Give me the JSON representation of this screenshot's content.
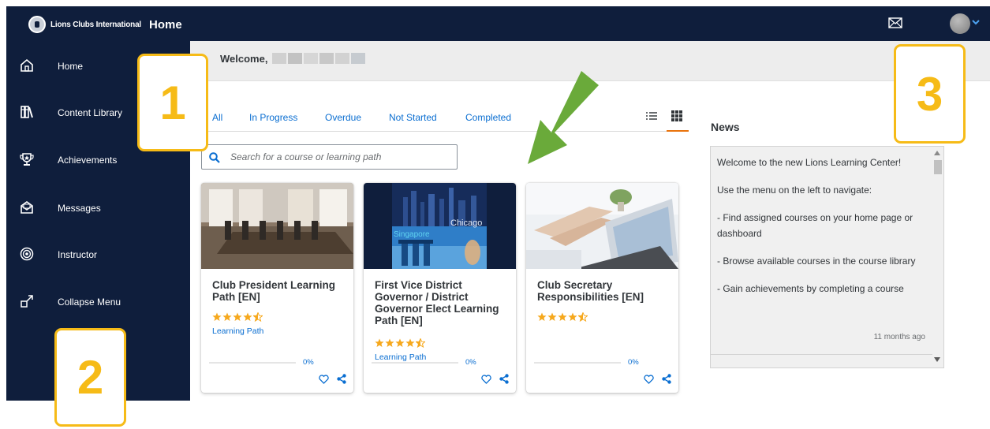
{
  "header": {
    "brand_name": "Lions Clubs International",
    "page_title": "Home",
    "mail_icon": "mail-icon",
    "avatar_icon": "avatar"
  },
  "sidebar": {
    "items": [
      {
        "label": "Home",
        "icon": "home-icon"
      },
      {
        "label": "Content Library",
        "icon": "library-icon"
      },
      {
        "label": "Achievements",
        "icon": "trophy-icon"
      },
      {
        "label": "Messages",
        "icon": "envelope-open-icon"
      },
      {
        "label": "Instructor",
        "icon": "instructor-icon"
      },
      {
        "label": "Collapse Menu",
        "icon": "collapse-icon"
      }
    ]
  },
  "welcome": {
    "text": "Welcome,"
  },
  "tabs": [
    {
      "label": "All"
    },
    {
      "label": "In Progress"
    },
    {
      "label": "Overdue"
    },
    {
      "label": "Not Started"
    },
    {
      "label": "Completed"
    }
  ],
  "view_toggle": {
    "active": "grid"
  },
  "search": {
    "placeholder": "Search for a course or learning path"
  },
  "cards": [
    {
      "title": "Club President Learning Path [EN]",
      "rating": 4.5,
      "type": "Learning Path",
      "progress": "0%"
    },
    {
      "title": "First Vice District Governor / District Governor Elect Learning Path [EN]",
      "rating": 4.5,
      "type": "Learning Path",
      "progress": "0%",
      "image_labels": [
        "Chicago",
        "Singapore"
      ]
    },
    {
      "title": "Club Secretary Responsibilities [EN]",
      "rating": 4.5,
      "type": "",
      "progress": "0%"
    }
  ],
  "news": {
    "title": "News",
    "paragraphs": [
      "Welcome to the new Lions Learning Center!",
      "Use the menu on the left to navigate:",
      "- Find assigned courses on your home page or dashboard",
      "- Browse available courses in the course library",
      "- Gain achievements by completing a course"
    ],
    "timestamp": "11 months ago"
  },
  "callouts": [
    "1",
    "2",
    "3"
  ],
  "colors": {
    "nav_bg": "#0f1e3c",
    "link_blue": "#0a6ed1",
    "star_orange": "#f6a81d",
    "callout_yellow": "#f6bb17",
    "arrow_green": "#6aaa3a",
    "tab_underline": "#e9730c"
  }
}
